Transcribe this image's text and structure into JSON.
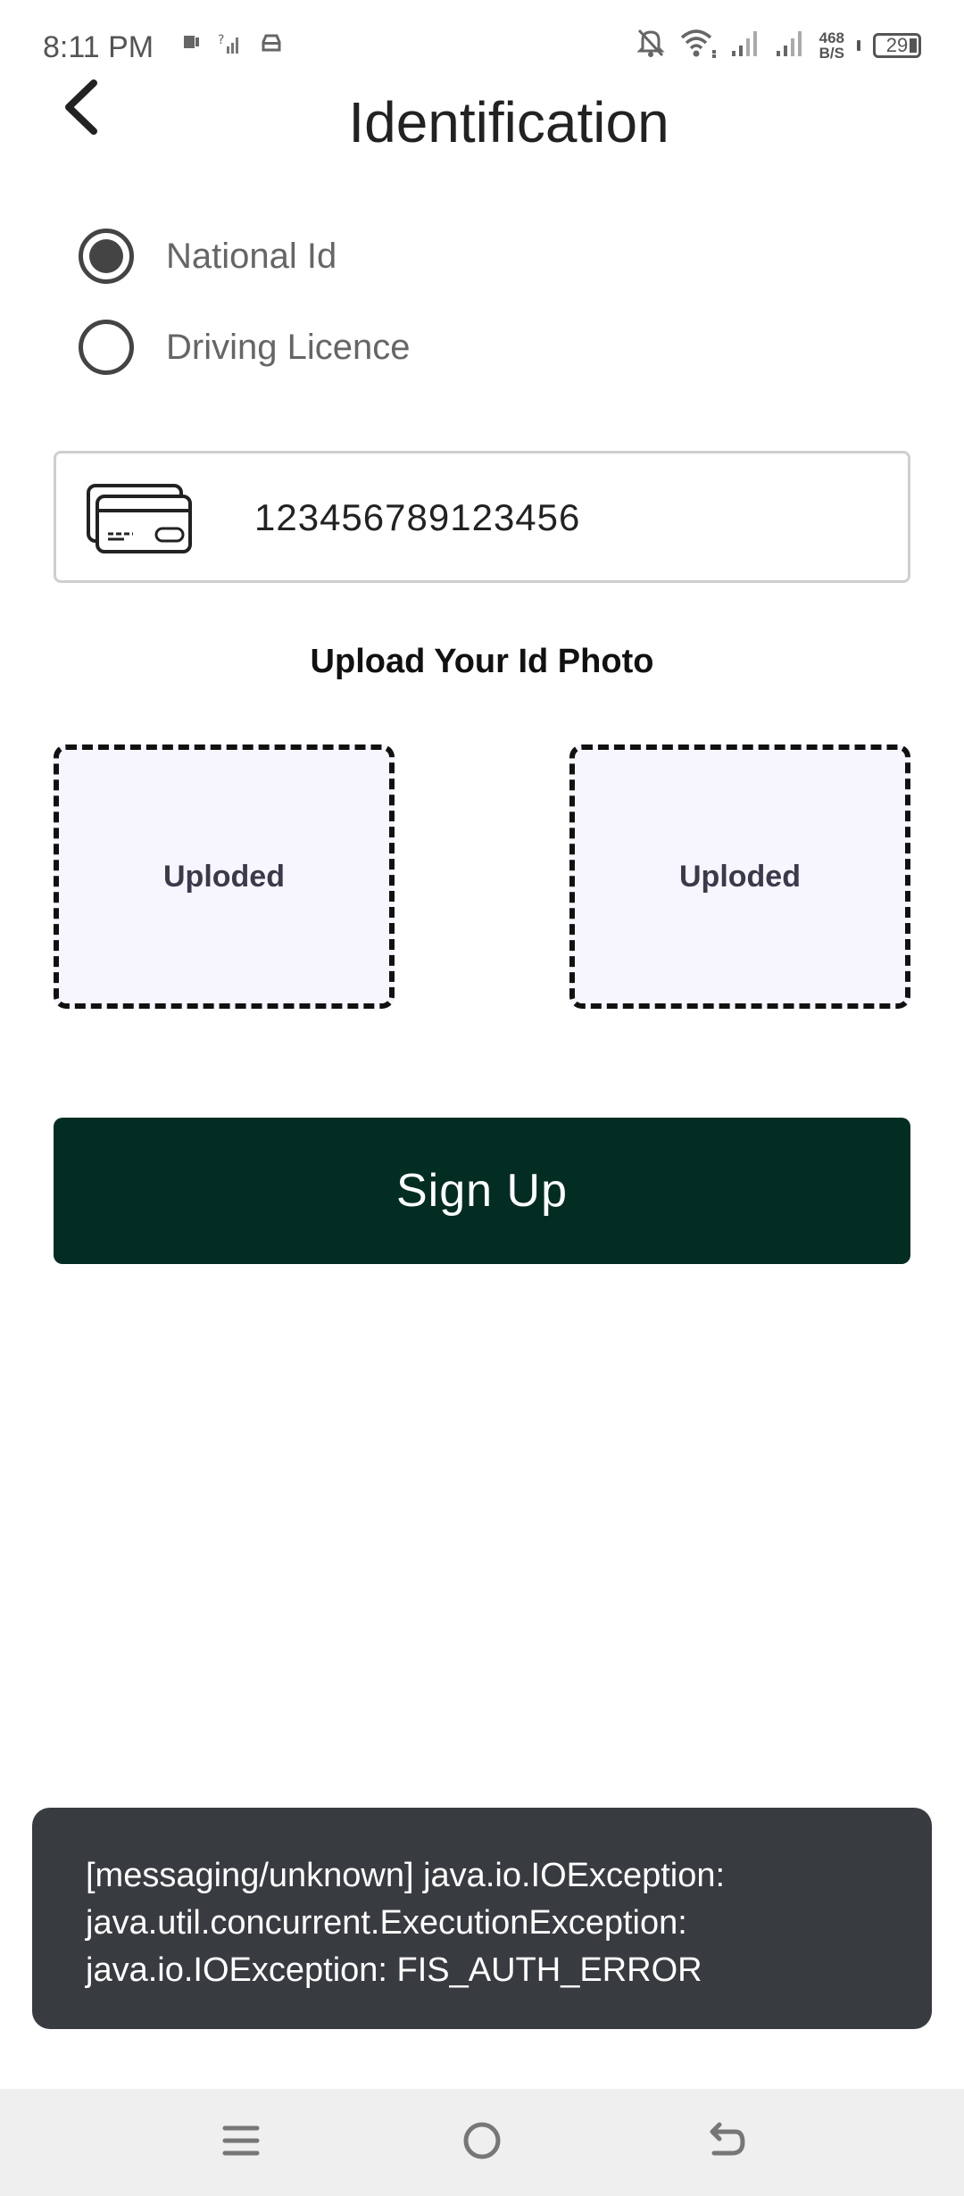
{
  "status_bar": {
    "time": "8:11 PM",
    "network_speed_value": "468",
    "network_speed_unit": "B/S",
    "battery": "29",
    "icons": [
      "notification-icon",
      "no-sim-icon",
      "car-icon",
      "bell-off-icon",
      "wifi-icon",
      "signal-icon",
      "signal-icon",
      "battery-icon"
    ]
  },
  "header": {
    "title": "Identification"
  },
  "id_type": {
    "options": [
      {
        "label": "National Id",
        "selected": true
      },
      {
        "label": "Driving Licence",
        "selected": false
      }
    ]
  },
  "id_input": {
    "value": "123456789123456"
  },
  "upload": {
    "heading": "Upload Your Id Photo",
    "front_label": "Uploded",
    "back_label": "Uploded"
  },
  "actions": {
    "signup_label": "Sign Up"
  },
  "toast": {
    "lines": [
      "[messaging/unknown] java.io.IOException:",
      "java.util.concurrent.ExecutionException:",
      "java.io.IOException: FIS_AUTH_ERROR"
    ]
  },
  "colors": {
    "primary": "#032d23",
    "toast_bg": "#383c40",
    "upload_bg": "#f7f5fe"
  }
}
